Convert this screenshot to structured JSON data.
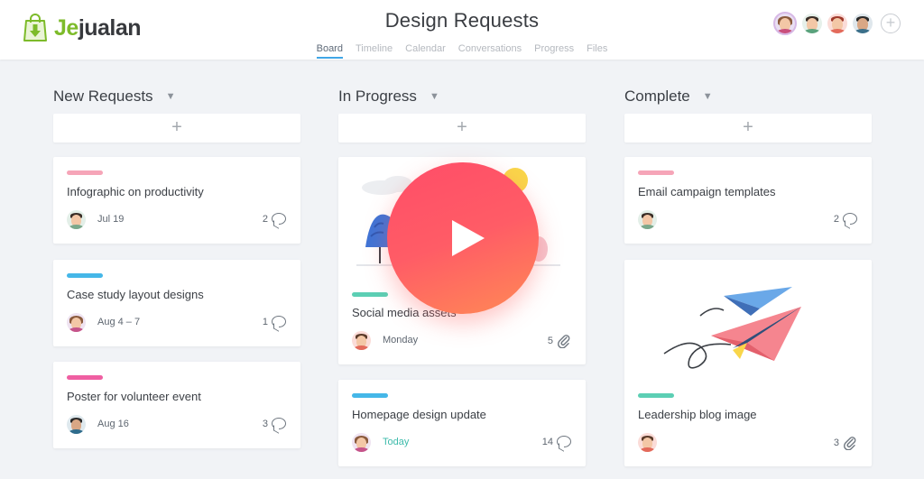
{
  "header": {
    "logo_je": "Je",
    "logo_rest": "jualan",
    "title": "Design Requests",
    "tabs": [
      "Board",
      "Timeline",
      "Calendar",
      "Conversations",
      "Progress",
      "Files"
    ],
    "active_tab": "Board",
    "add_member_icon": "+"
  },
  "columns": [
    {
      "title": "New Requests",
      "add_label": "+",
      "cards": [
        {
          "title": "Infographic on productivity",
          "tag_color": "#f6a5b8",
          "date": "Jul 19",
          "comments": "2"
        },
        {
          "title": "Case study layout designs",
          "tag_color": "#45b7e8",
          "date": "Aug 4 – 7",
          "comments": "1"
        },
        {
          "title": "Poster for volunteer event",
          "tag_color": "#ef5fa2",
          "date": "Aug 16",
          "comments": "3"
        }
      ]
    },
    {
      "title": "In Progress",
      "add_label": "+",
      "cards": [
        {
          "title": "Social media assets",
          "tag_color": "#5ccfb4",
          "date": "Monday",
          "attachments": "5"
        },
        {
          "title": "Homepage design update",
          "tag_color": "#45b7e8",
          "date": "Today",
          "comments": "14"
        }
      ]
    },
    {
      "title": "Complete",
      "add_label": "+",
      "cards": [
        {
          "title": "Email campaign templates",
          "tag_color": "#f6a5b8",
          "comments": "2"
        },
        {
          "title": "Leadership blog image",
          "tag_color": "#5ccfb4",
          "attachments": "3"
        }
      ]
    }
  ],
  "icons": {
    "dropdown": "chevron-down-icon",
    "comment": "comment-icon",
    "attachment": "paperclip-icon",
    "play": "play-icon"
  },
  "colors": {
    "brand_green": "#7dbb2a",
    "active_tab_underline": "#40a6e6",
    "play_gradient_start": "#ff4d68",
    "play_gradient_end": "#ff8a55",
    "today_text": "#3dbbab"
  }
}
